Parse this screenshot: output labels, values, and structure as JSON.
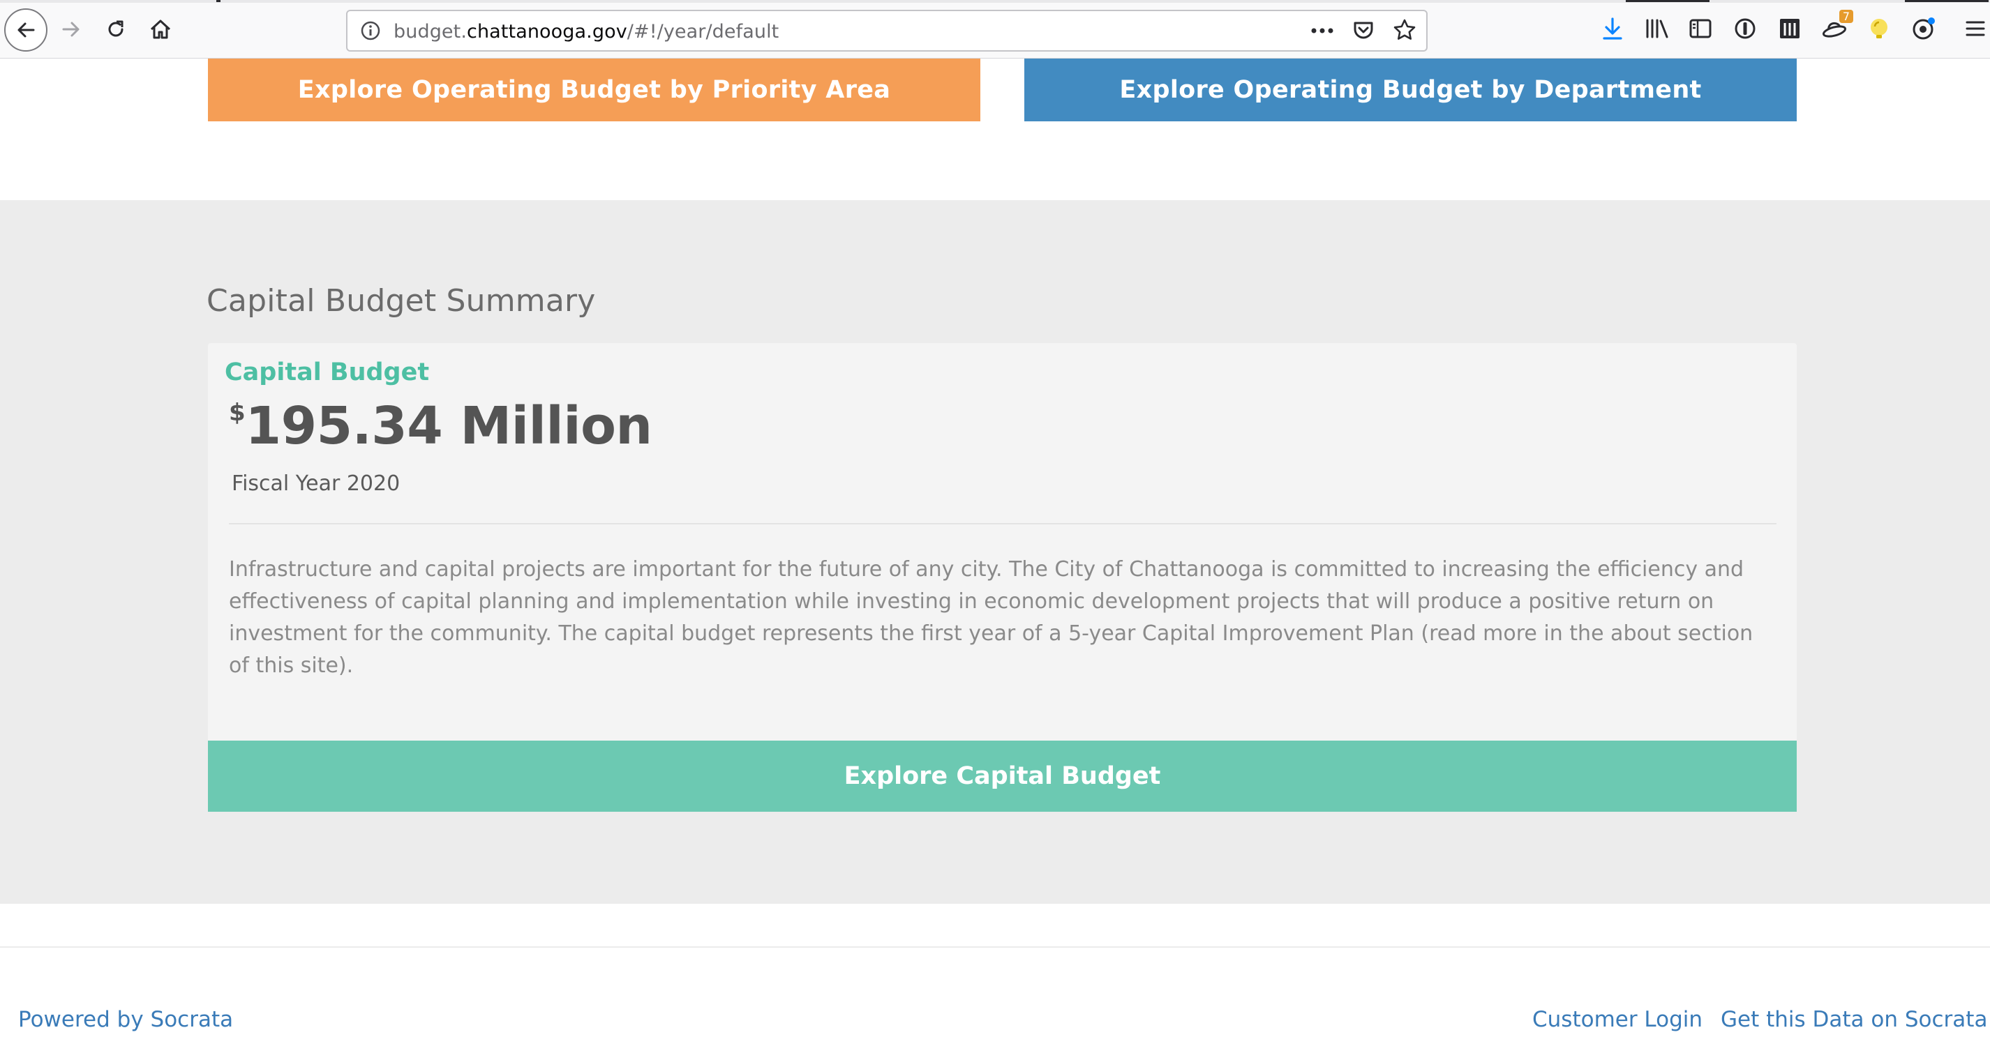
{
  "browser": {
    "url_prefix": "budget.",
    "url_host": "chattanooga.gov",
    "url_path": "/#!/year/default",
    "url_actions_icon": "more-actions-icon",
    "extension_badge_count": "7",
    "accent_color": "#0a84ff"
  },
  "buttons": {
    "priority_area": "Explore Operating Budget by Priority Area",
    "department": "Explore Operating Budget by Department",
    "capital": "Explore Capital Budget"
  },
  "capital_summary": {
    "section_title": "Capital Budget Summary",
    "card_label": "Capital Budget",
    "currency_symbol": "$",
    "amount": "195.34 Million",
    "fiscal_year": "Fiscal Year 2020",
    "description": "Infrastructure and capital projects are important for the future of any city. The City of Chattanooga is committed to increasing the efficiency and effectiveness of capital planning and implementation while investing in economic development projects that will produce a positive return on investment for the community. The capital budget represents the first year of a 5-year Capital Improvement Plan (read more in the about section of this site)."
  },
  "footer": {
    "powered_by": "Powered by Socrata",
    "customer_login": "Customer Login",
    "get_data": "Get this Data on Socrata"
  },
  "colors": {
    "priority_button": "#f59e56",
    "department_button": "#428bc1",
    "capital_button": "#6cc9b2",
    "capital_label": "#4dbfa3",
    "link": "#3a7bb8",
    "section_background": "#ececec"
  }
}
